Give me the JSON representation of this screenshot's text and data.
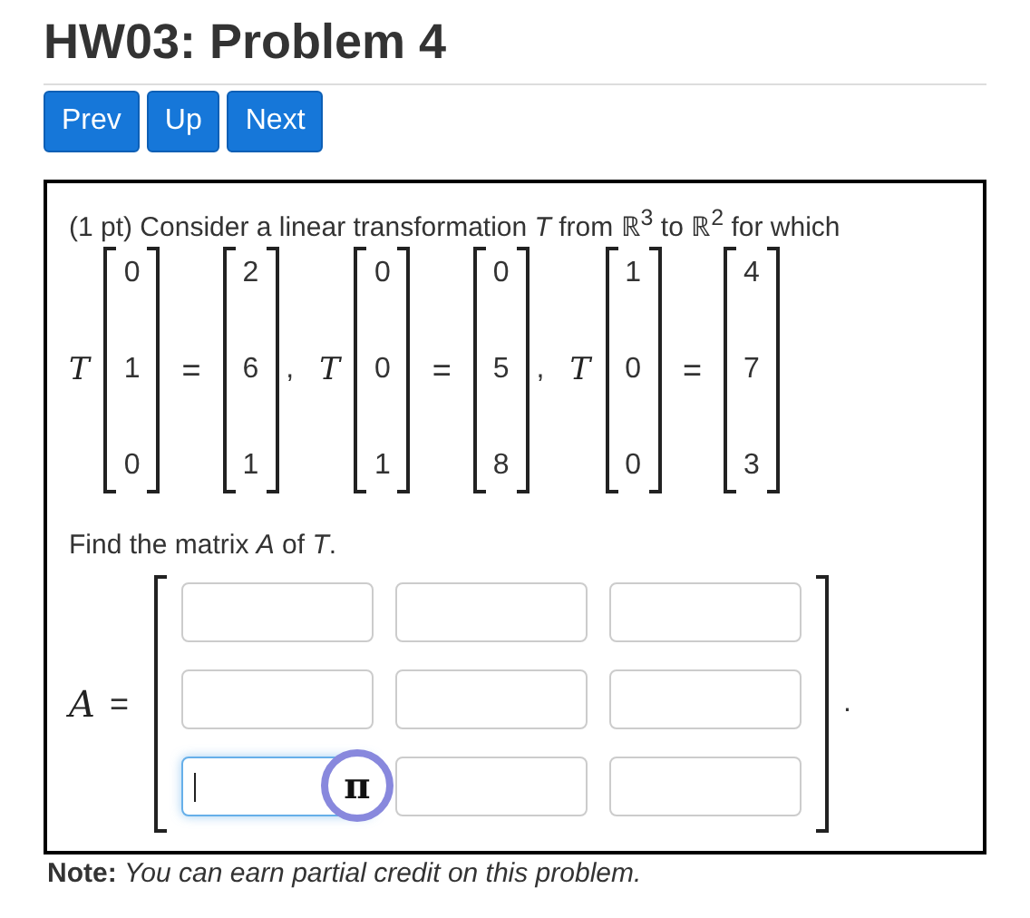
{
  "title": "HW03: Problem 4",
  "nav_buttons": [
    "Prev",
    "Up",
    "Next"
  ],
  "problem": {
    "intro": "(1 pt) Consider a linear transformation *T* from ℝ$^{3}$ to ℝ$^{2}$ for which",
    "equations": [
      {
        "func": "T",
        "input": [
          "0",
          "1",
          "0"
        ],
        "equals": "=",
        "output": [
          "2",
          "6",
          "1"
        ],
        "separator": ","
      },
      {
        "func": "T",
        "input": [
          "0",
          "0",
          "1"
        ],
        "equals": "=",
        "output": [
          "0",
          "5",
          "8"
        ],
        "separator": ","
      },
      {
        "func": "T",
        "input": [
          "1",
          "0",
          "0"
        ],
        "equals": "=",
        "output": [
          "4",
          "7",
          "3"
        ]
      }
    ],
    "question": "Find the matrix *A* of *T*.",
    "answer": {
      "label": "A",
      "equals": "=",
      "end": ".",
      "rows": [
        [
          {
            "focused": false
          },
          {
            "focused": false
          },
          {
            "focused": false
          }
        ],
        [
          {
            "focused": false
          },
          {
            "focused": false
          },
          {
            "focused": false
          }
        ],
        [
          {
            "focused": true
          },
          {
            "focused": false
          },
          {
            "focused": false
          }
        ]
      ],
      "equation_button": {
        "symbol": "π"
      }
    }
  },
  "note": "**Note:** *You can earn partial credit on this problem.*"
}
